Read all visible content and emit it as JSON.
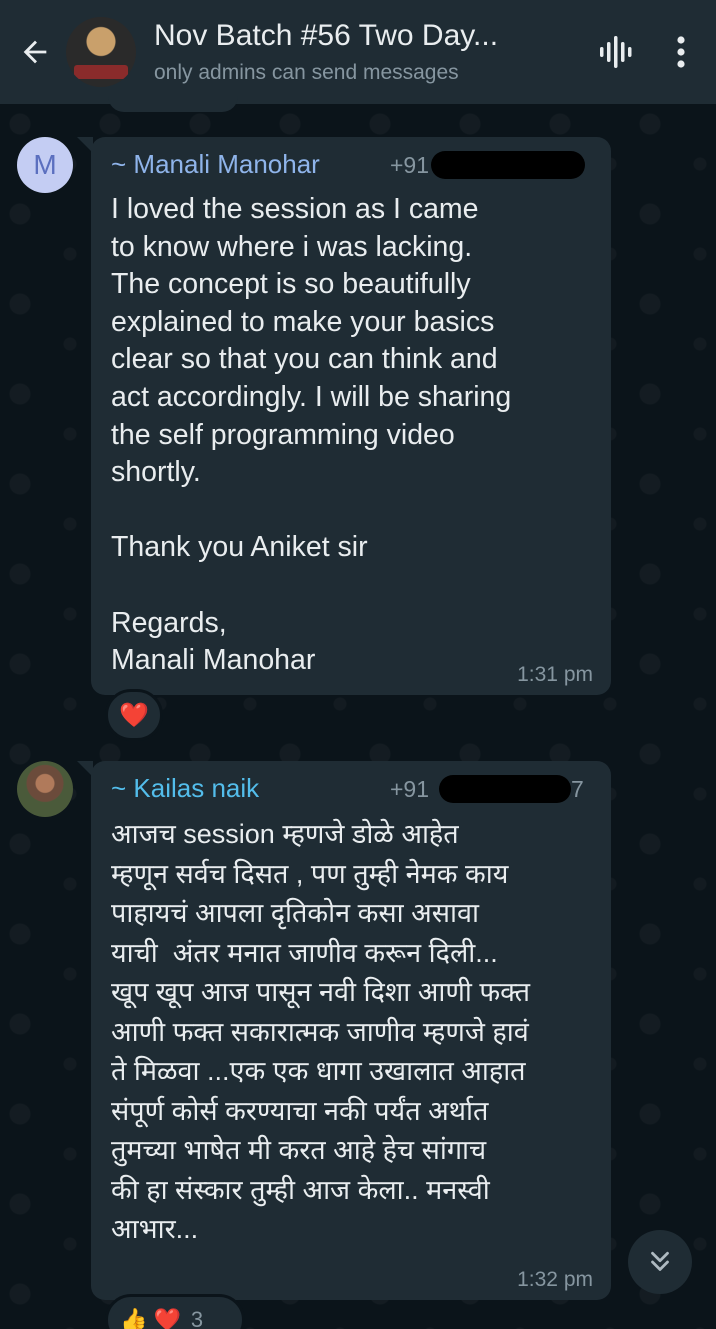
{
  "header": {
    "title": "Nov Batch #56 Two Day...",
    "subtitle": "only admins can send messages",
    "back_icon": "arrow-left-icon",
    "voice_icon": "audio-wave-icon",
    "menu_icon": "more-vertical-icon"
  },
  "messages": [
    {
      "avatar_letter": "M",
      "sender": "~ Manali Manohar",
      "phone": "+91",
      "text": "I loved the session as I came\nto know where i was lacking.\nThe concept is so beautifully\nexplained to make your basics\nclear so that you can think and\nact accordingly. I will be sharing\nthe self programming video\nshortly.\n\nThank you Aniket sir\n\nRegards,\nManali Manohar",
      "time": "1:31 pm",
      "reaction": "❤️"
    },
    {
      "sender": "~ Kailas naik",
      "phone": "+91",
      "phone_tail": "7",
      "text": "आजच session म्हणजे डोळे आहेत\nम्हणून सर्वच दिसत , पण तुम्ही नेमक काय\nपाहायचं आपला दृतिकोन कसा असावा\nयाची  अंतर मनात जाणीव करून दिली...\nखूप खूप आज पासून नवी दिशा आणी फक्त\nआणी फक्त सकारात्मक जाणीव म्हणजे हावं\nते मिळवा ...एक एक धागा उखालात आहात\nसंपूर्ण कोर्स करण्याचा नकी पर्यंत अर्थात\nतुमच्या भाषेत मी करत आहे हेच सांगाच\nकी हा संस्कार तुम्ही आज केला.. मनस्वी\nआभार...",
      "time": "1:32 pm",
      "reactions": "👍 ❤️",
      "reaction_count": "3"
    }
  ],
  "colors": {
    "header_bg": "#1f2c34",
    "bubble_bg": "#1f2c34",
    "chat_bg": "#0b141a",
    "sender1": "#8fb4ea",
    "sender2": "#53bdeb",
    "muted": "#8696a0"
  }
}
